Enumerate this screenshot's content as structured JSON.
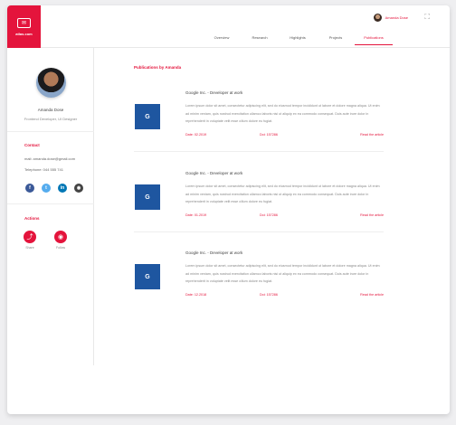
{
  "brand": {
    "logo_label": "atlas.com"
  },
  "header": {
    "user_name": "Amanda Dose"
  },
  "nav": {
    "tabs": [
      {
        "label": "Overview"
      },
      {
        "label": "Research"
      },
      {
        "label": "Highlights"
      },
      {
        "label": "Projects"
      },
      {
        "label": "Publications"
      }
    ]
  },
  "profile": {
    "name": "Amanda Dose",
    "title": "Frontend Developer, UI Designer",
    "contact_heading": "Contact",
    "email": "mail: amanda.dose@gmail.com",
    "phone": "Telephone: 044 555 741",
    "actions_heading": "Actions",
    "actions": [
      {
        "label": "Share"
      },
      {
        "label": "Follow"
      }
    ]
  },
  "main": {
    "section_title": "Publications by Amanda",
    "publications": [
      {
        "thumb_letter": "G",
        "title": "Google Inc. - Developer at work",
        "description": "Lorem ipsum dolor sit amet, consectetur adipiscing elit, sed do eiusmod tempor incididunt ut labore et dolore magna aliqua. Ut enim ad minim veniam, quis nostrud exercitation ullamco laboris nisi ut aliquip ex ea commodo consequat. Duis aute irure dolor in reprehenderit in voluptate velit esse cillum dolore eu fugiat.",
        "date": "Date: 02.2019",
        "doi": "Doi: 157286",
        "more": "Read the article"
      },
      {
        "thumb_letter": "G",
        "title": "Google Inc. - Developer at work",
        "description": "Lorem ipsum dolor sit amet, consectetur adipiscing elit, sed do eiusmod tempor incididunt ut labore et dolore magna aliqua. Ut enim ad minim veniam, quis nostrud exercitation ullamco laboris nisi ut aliquip ex ea commodo consequat. Duis aute irure dolor in reprehenderit in voluptate velit esse cillum dolore eu fugiat.",
        "date": "Date: 01.2019",
        "doi": "Doi: 157286",
        "more": "Read the article"
      },
      {
        "thumb_letter": "G",
        "title": "Google Inc. - Developer at work",
        "description": "Lorem ipsum dolor sit amet, consectetur adipiscing elit, sed do eiusmod tempor incididunt ut labore et dolore magna aliqua. Ut enim ad minim veniam, quis nostrud exercitation ullamco laboris nisi ut aliquip ex ea commodo consequat. Duis aute irure dolor in reprehenderit in voluptate velit esse cillum dolore eu fugiat.",
        "date": "Date: 12.2018",
        "doi": "Doi: 157286",
        "more": "Read the article"
      }
    ]
  },
  "colors": {
    "accent": "#e4143c",
    "thumb": "#1e56a0",
    "facebook": "#3b5998",
    "twitter": "#55acee",
    "linkedin": "#0077b5",
    "github": "#444444"
  },
  "icons": {
    "logo": "mail-icon",
    "expand": "fullscreen-icon",
    "share": "share-icon",
    "follow": "eye-icon",
    "socials": [
      "facebook-icon",
      "twitter-icon",
      "linkedin-icon",
      "github-icon"
    ]
  }
}
